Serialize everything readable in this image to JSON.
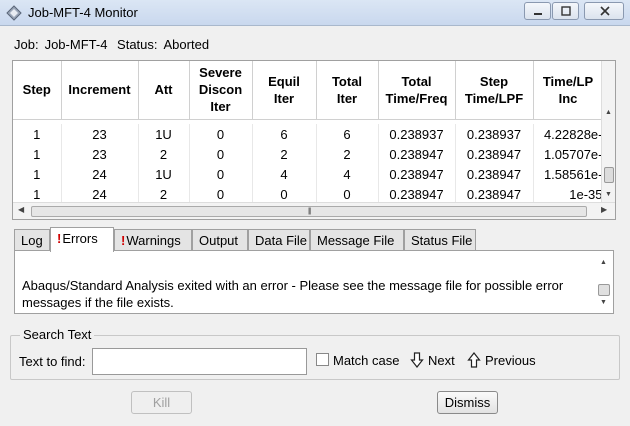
{
  "window": {
    "title": "Job-MFT-4 Monitor"
  },
  "job": {
    "job_label": "Job:",
    "job_name": "Job-MFT-4",
    "status_label": "Status:",
    "status_value": "Aborted"
  },
  "table": {
    "headers": [
      [
        "Step"
      ],
      [
        "Increment"
      ],
      [
        "Att"
      ],
      [
        "Severe",
        "Discon",
        "Iter"
      ],
      [
        "Equil",
        "Iter"
      ],
      [
        "Total",
        "Iter"
      ],
      [
        "Total",
        "Time/Freq"
      ],
      [
        "Step",
        "Time/LPF"
      ],
      [
        "Time/LP",
        "Inc"
      ]
    ],
    "rows": [
      [
        "1",
        "23",
        "1U",
        "0",
        "6",
        "6",
        "0.238937",
        "0.238937",
        "4.22828e-"
      ],
      [
        "1",
        "23",
        "2",
        "0",
        "2",
        "2",
        "0.238947",
        "0.238947",
        "1.05707e-"
      ],
      [
        "1",
        "24",
        "1U",
        "0",
        "4",
        "4",
        "0.238947",
        "0.238947",
        "1.58561e-"
      ],
      [
        "1",
        "24",
        "2",
        "0",
        "0",
        "0",
        "0.238947",
        "0.238947",
        "1e-35"
      ]
    ]
  },
  "tabs": [
    {
      "label": "Log",
      "warn": false
    },
    {
      "label": "Errors",
      "warn": true
    },
    {
      "label": "Warnings",
      "warn": true
    },
    {
      "label": "Output",
      "warn": false
    },
    {
      "label": "Data File",
      "warn": false
    },
    {
      "label": "Message File",
      "warn": false
    },
    {
      "label": "Status File",
      "warn": false
    }
  ],
  "tab_marker": "!",
  "message": "Abaqus/Standard Analysis exited with an error - Please see the  message file for possible error messages if the file exists.",
  "search": {
    "legend": "Search Text",
    "find_label": "Text to find:",
    "find_value": "",
    "match_case_label": "Match case",
    "next_label": "Next",
    "previous_label": "Previous"
  },
  "buttons": {
    "kill": "Kill",
    "dismiss": "Dismiss"
  }
}
